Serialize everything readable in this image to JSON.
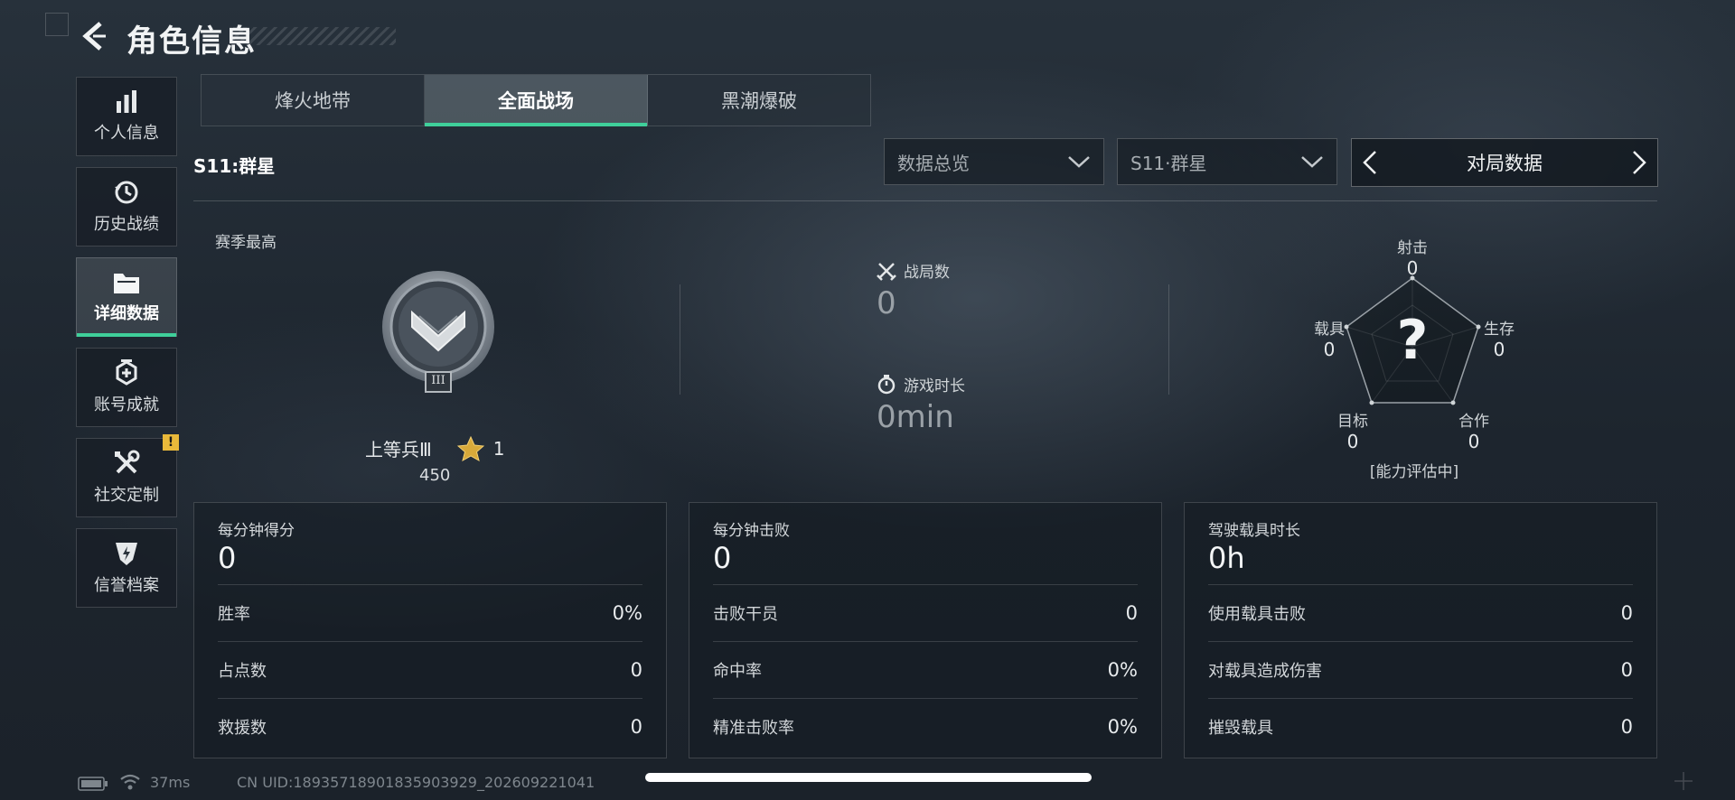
{
  "header": {
    "title": "角色信息"
  },
  "sidebar": {
    "items": [
      {
        "label": "个人信息",
        "icon": "bar-chart-icon"
      },
      {
        "label": "历史战绩",
        "icon": "history-icon"
      },
      {
        "label": "详细数据",
        "icon": "folder-icon"
      },
      {
        "label": "账号成就",
        "icon": "achievement-icon"
      },
      {
        "label": "社交定制",
        "icon": "tools-icon"
      },
      {
        "label": "信誉档案",
        "icon": "shield-lightning-icon"
      }
    ],
    "active_index": 2,
    "warning_badge": "!"
  },
  "tabs": [
    "烽火地带",
    "全面战场",
    "黑潮爆破"
  ],
  "active_tab": 1,
  "season_title": "S11:群星",
  "filters": {
    "dropdown1": "数据总览",
    "dropdown2": "S11·群星",
    "nav_label": "对局数据"
  },
  "rank": {
    "section_label": "赛季最高",
    "rank_name": "上等兵Ⅲ",
    "stars": "1",
    "score": "450",
    "badge_numeral": "III"
  },
  "summary": {
    "matches_label": "战局数",
    "matches_value": "0",
    "time_label": "游戏时长",
    "time_value": "0min"
  },
  "radar": {
    "center_symbol": "?",
    "status": "[能力评估中]",
    "axes": [
      {
        "label": "射击",
        "value": "0"
      },
      {
        "label": "生存",
        "value": "0"
      },
      {
        "label": "合作",
        "value": "0"
      },
      {
        "label": "目标",
        "value": "0"
      },
      {
        "label": "载具",
        "value": "0"
      }
    ]
  },
  "panels": [
    {
      "header": "每分钟得分",
      "value": "0",
      "rows": [
        {
          "label": "胜率",
          "value": "0%"
        },
        {
          "label": "占点数",
          "value": "0"
        },
        {
          "label": "救援数",
          "value": "0"
        }
      ]
    },
    {
      "header": "每分钟击败",
      "value": "0",
      "rows": [
        {
          "label": "击败干员",
          "value": "0"
        },
        {
          "label": "命中率",
          "value": "0%"
        },
        {
          "label": "精准击败率",
          "value": "0%"
        }
      ]
    },
    {
      "header": "驾驶载具时长",
      "value": "0h",
      "rows": [
        {
          "label": "使用载具击败",
          "value": "0"
        },
        {
          "label": "对载具造成伤害",
          "value": "0"
        },
        {
          "label": "摧毁载具",
          "value": "0"
        }
      ]
    }
  ],
  "footer": {
    "ping": "37ms",
    "uid": "CN UID:1893571890183590392​9_202609221041"
  },
  "colors": {
    "accent": "#3fcf9a",
    "warning": "#e9b93a"
  }
}
